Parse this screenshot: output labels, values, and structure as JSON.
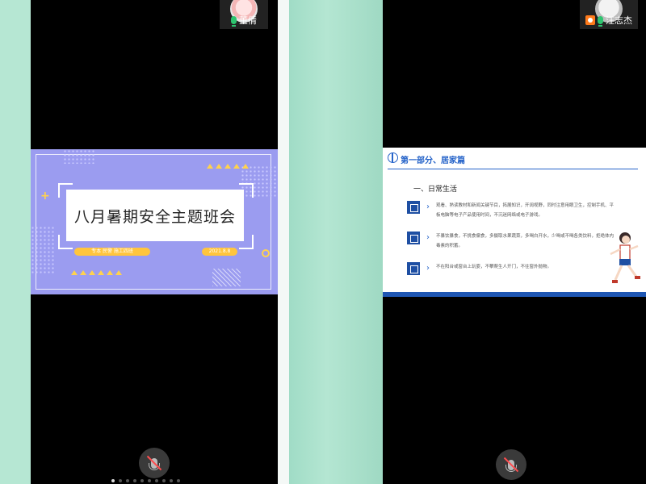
{
  "left_call": {
    "participant": {
      "name": "董倩"
    },
    "slide": {
      "title": "八月暑期安全主题班会",
      "footer_left": "专本 民警 施工四班",
      "footer_right": "2021.8.8"
    },
    "mic_button": {
      "icon": "mic-off-icon"
    },
    "page_indicator": {
      "count": 10,
      "active_index": 0
    }
  },
  "right_call": {
    "participant": {
      "name": "汪志杰"
    },
    "slide": {
      "section_title": "第一部分、居家篇",
      "subheading": "一、日常生活",
      "items": [
        {
          "icon": "clock-icon",
          "text": "观看、熟读教材和新闻关键节目，拓展知识，开阔视野，同时注意用眼卫生，控制手机、平板电脑等电子产品使用时间，不沉迷网络或电子游戏。"
        },
        {
          "icon": "food-icon",
          "text": "不暴饮暴食，不挑食偏食，多摄取水果蔬菜，多喝白开水，少喝或不喝各类饮料，拒绝体内毒素的积蓄。"
        },
        {
          "icon": "window-icon",
          "text": "不在阳台或窗台上玩耍，不攀爬生人开门，不往窗外抛物。"
        }
      ]
    },
    "mic_button": {
      "icon": "mic-off-icon"
    }
  },
  "colors": {
    "background": "#a8ddc9",
    "slide_left_bg": "#9b9cf0",
    "accent_blue": "#2563c9",
    "accent_yellow": "#ffc53d",
    "mic_active": "#2ec46f",
    "mic_muted": "#ff4d4f"
  }
}
